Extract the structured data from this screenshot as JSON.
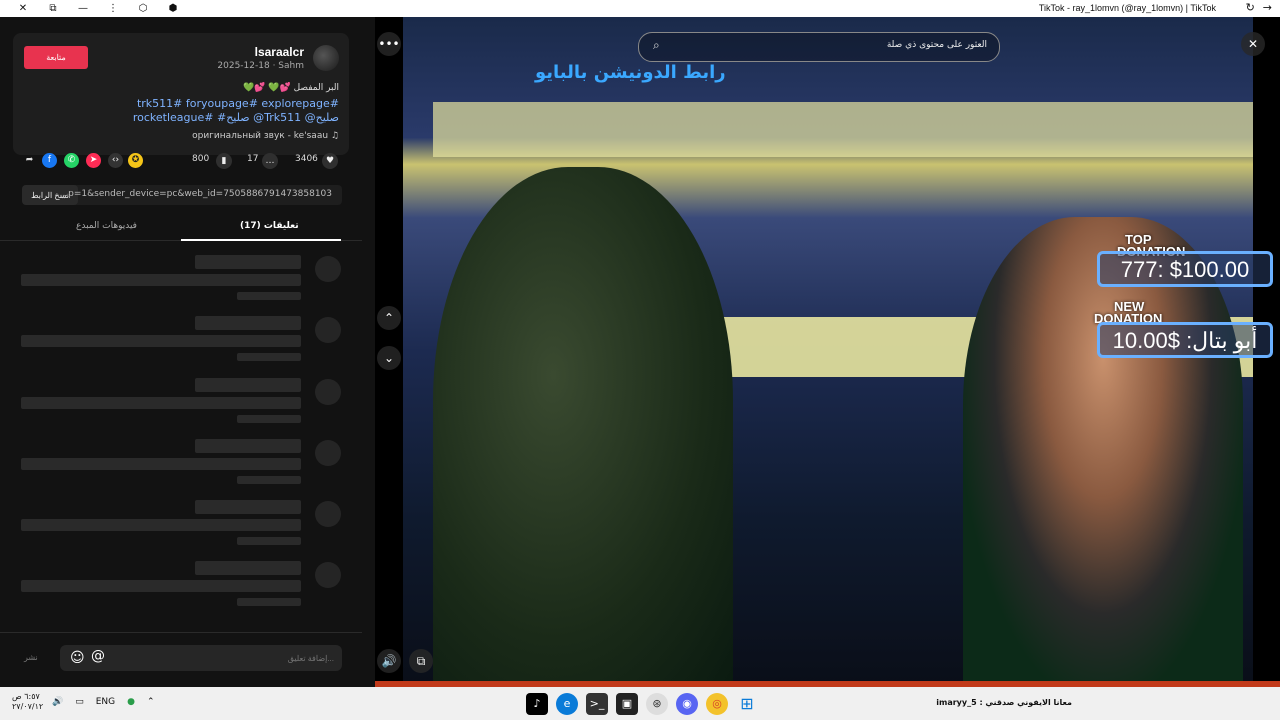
{
  "window": {
    "title": "TikTok - ray_1lomvn (@ray_1lomvn) | TikTok",
    "left_icons": [
      "✕",
      "⧉",
      "—",
      "⋮",
      "⬡",
      "⬢"
    ],
    "right_icons": [
      "↻",
      "→"
    ]
  },
  "post": {
    "username": "lsaraalcr",
    "meta": "2025-12-18 · Sahm",
    "follow_label": "متابعة",
    "description_line1": "البر المفصل 💕💚 💕💚",
    "description_line2": "trk511# foryoupage# explorepage#",
    "description_line3": "rocketleague# #صليح @Trk511 @صليح",
    "sound": "оригинальный звук - ke'saau",
    "likes": "3406",
    "comments": "17",
    "saves": "800",
    "link_text": "...p=1&sender_device=pc&web_id=7505886791473858103",
    "copy_link_label": "نسخ الرابط",
    "tab_comments": "(17) تعليقات",
    "tab_creator_videos": "فيديوهات المبدع",
    "post_label": "نشر",
    "comment_placeholder": "إضافة تعليق..."
  },
  "share_icons": [
    "share-arrow",
    "facebook",
    "whatsapp",
    "telegram",
    "embed",
    "coin"
  ],
  "video": {
    "search_placeholder": "العثور على محتوى ذي صلة",
    "overlay_text": "رابط الدونيشن بالبايو",
    "top_donation_label_1": "TOP",
    "top_donation_label_2": "DONATION",
    "top_donation_value": "777: $100.00",
    "new_donation_label_1": "NEW",
    "new_donation_label_2": "DONATION",
    "new_donation_value": "أبو بتال: $10.00"
  },
  "taskbar": {
    "time": "٦:٥٧ ص",
    "date": "٢٧/٠٧/١٢",
    "lang": "ENG",
    "notification": "imaryy_5 : معانا الايفوني صدقني"
  },
  "colors": {
    "accent": "#e8334f",
    "link": "#7fb3ff",
    "donation_border": "#6ab0ff"
  }
}
